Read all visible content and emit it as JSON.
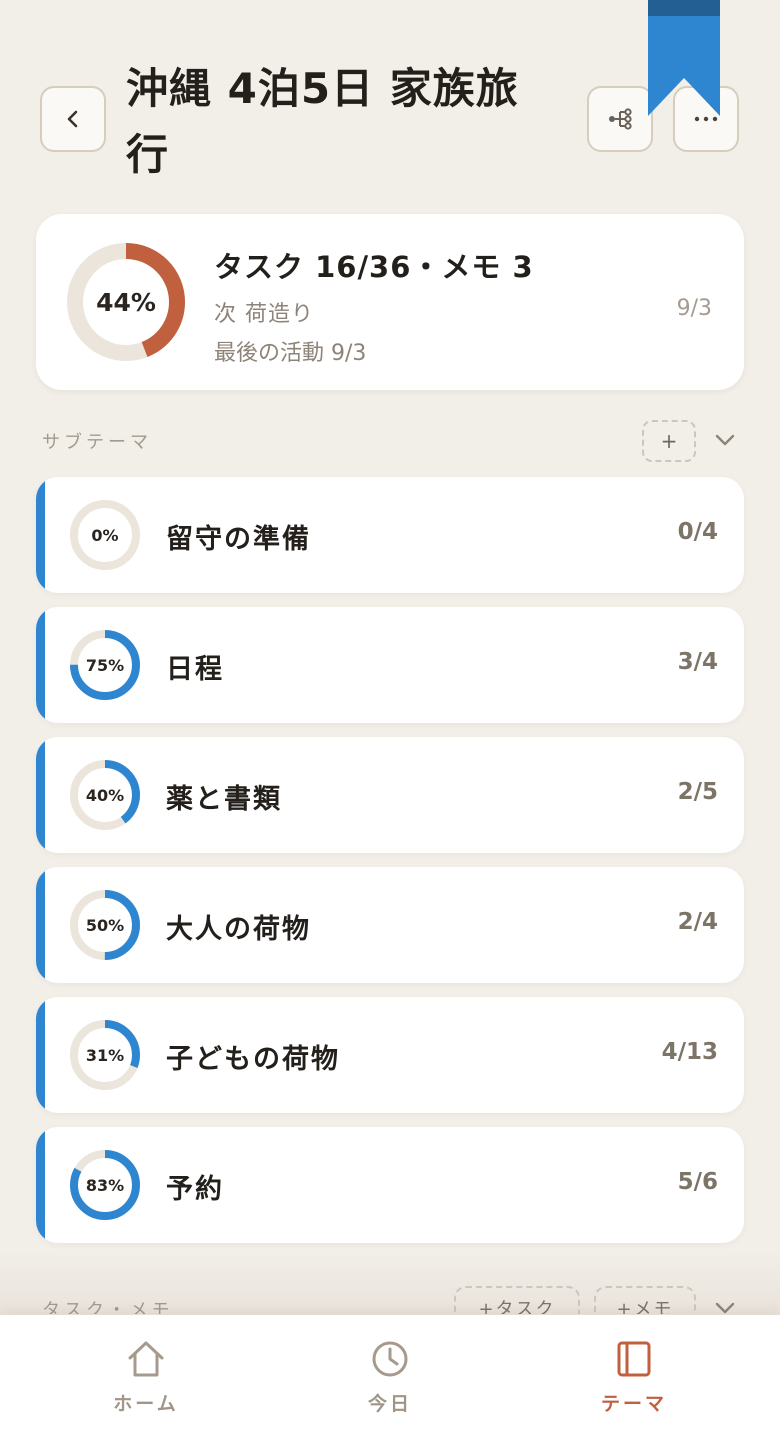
{
  "header": {
    "title": "沖縄 4泊5日 家族旅行",
    "back_icon": "chevron-left-icon",
    "tree_icon": "hierarchy-icon",
    "more_icon": "more-horizontal-icon",
    "bookmark_icon": "bookmark-icon",
    "colors": {
      "bookmark": "#2f86d0",
      "bookmark_top": "#245f93"
    }
  },
  "summary": {
    "progress_label": "44%",
    "progress": 0.44,
    "counts": "タスク 16/36・メモ 3",
    "next": "次  荷造り",
    "next_date": "9/3",
    "last_activity": "最後の活動 9/3",
    "ring_color": "#c0603f"
  },
  "subthemes": {
    "label": "サブテーマ",
    "add_label": "+",
    "items": [
      {
        "name": "留守の準備",
        "percent_label": "0%",
        "progress": 0.0,
        "count": "0/4"
      },
      {
        "name": "日程",
        "percent_label": "75%",
        "progress": 0.75,
        "count": "3/4"
      },
      {
        "name": "薬と書類",
        "percent_label": "40%",
        "progress": 0.4,
        "count": "2/5"
      },
      {
        "name": "大人の荷物",
        "percent_label": "50%",
        "progress": 0.5,
        "count": "2/4"
      },
      {
        "name": "子どもの荷物",
        "percent_label": "31%",
        "progress": 0.31,
        "count": "4/13"
      },
      {
        "name": "予約",
        "percent_label": "83%",
        "progress": 0.83,
        "count": "5/6"
      }
    ],
    "ring_color": "#2f86d0",
    "track_color": "#ebe5dc"
  },
  "tasks_memos": {
    "label": "タスク・メモ",
    "add_task": "+タスク",
    "add_memo": "+メモ"
  },
  "nav": {
    "items": [
      {
        "label": "ホーム",
        "icon": "home-icon"
      },
      {
        "label": "今日",
        "icon": "clock-icon"
      },
      {
        "label": "テーマ",
        "icon": "notebook-icon"
      }
    ],
    "active_color": "#c0603f"
  }
}
